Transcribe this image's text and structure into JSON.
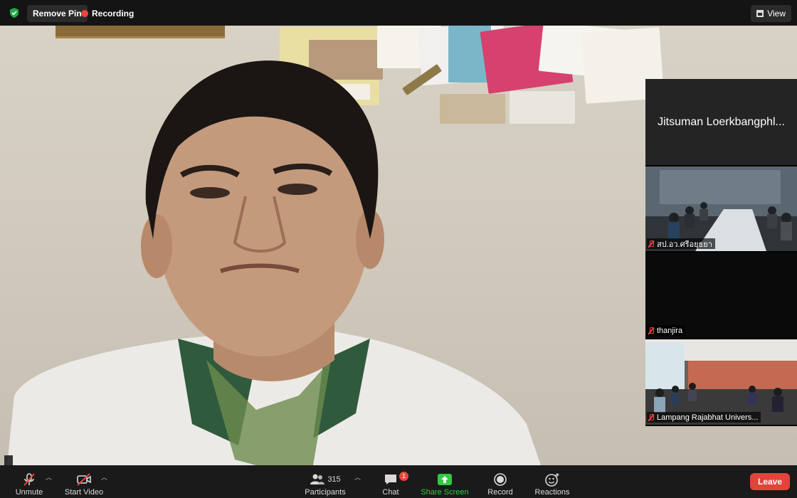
{
  "topbar": {
    "shield_icon": "shield-check-icon",
    "remove_pin_label": "Remove Pin",
    "recording_label": "Recording",
    "view_label": "View"
  },
  "main_video": {
    "speaker_name": "",
    "mic_status": "muted"
  },
  "gallery": [
    {
      "name": "Jitsuman Loerkbangphl...",
      "has_video": false
    },
    {
      "name": "สป.อว.ศรีอยุธยา",
      "has_video": true,
      "muted": true
    },
    {
      "name": "thanjira",
      "has_video": false,
      "muted": true
    },
    {
      "name": "Lampang Rajabhat Univers...",
      "has_video": true,
      "muted": true
    }
  ],
  "toolbar": {
    "unmute_label": "Unmute",
    "start_video_label": "Start Video",
    "participants_label": "Participants",
    "participants_count": "315",
    "chat_label": "Chat",
    "chat_badge": "1",
    "share_label": "Share Screen",
    "record_label": "Record",
    "reactions_label": "Reactions",
    "leave_label": "Leave"
  },
  "colors": {
    "accent_green": "#2ecc40",
    "leave_red": "#e0443a",
    "recording_red": "#e8463c"
  }
}
